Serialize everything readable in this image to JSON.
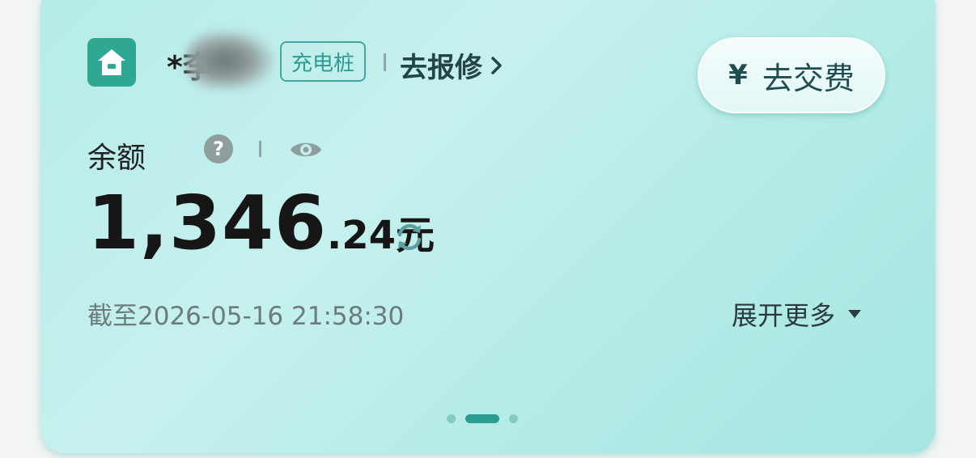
{
  "account": {
    "name": "*李",
    "tag": "充电桩",
    "repair_label": "去报修"
  },
  "pay_button": {
    "symbol": "¥",
    "label": "去交费"
  },
  "balance": {
    "label": "余额",
    "help_symbol": "?",
    "amount_integer": "1,346",
    "amount_decimal": ".24",
    "unit": "元",
    "timestamp": "截至2026-05-16 21:58:30",
    "expand_label": "展开更多"
  },
  "pager": {
    "count": 3,
    "active_index": 1
  },
  "colors": {
    "card_bg": "#b8ede9",
    "accent": "#2fa893",
    "tag_border": "#43a79f"
  },
  "icons": [
    "home-icon",
    "chevron-right-icon",
    "yen-icon",
    "help-icon",
    "eye-icon",
    "refresh-icon",
    "caret-down-icon"
  ]
}
